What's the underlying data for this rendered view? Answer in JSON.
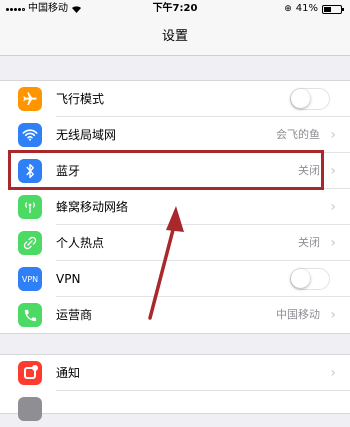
{
  "status_bar": {
    "carrier": "中国移动",
    "time": "下午7:20",
    "battery_percent": "41%",
    "battery_level": 0.41
  },
  "nav": {
    "title": "设置"
  },
  "group1": {
    "airplane": {
      "label": "飞行模式",
      "on": false,
      "icon": "airplane-icon",
      "color": "#ff9500"
    },
    "wifi": {
      "label": "无线局域网",
      "value": "会飞的鱼",
      "icon": "wifi-icon",
      "color": "#2f7ff6"
    },
    "bluetooth": {
      "label": "蓝牙",
      "value": "关闭",
      "icon": "bluetooth-icon",
      "color": "#2f7ff6"
    },
    "cellular": {
      "label": "蜂窝移动网络",
      "icon": "antenna-icon",
      "color": "#4cd964"
    },
    "hotspot": {
      "label": "个人热点",
      "value": "关闭",
      "icon": "hotspot-icon",
      "color": "#4cd964"
    },
    "vpn": {
      "label": "VPN",
      "icon_text": "VPN",
      "on": false,
      "icon": "vpn-icon",
      "color": "#2f7ff6"
    },
    "carrier": {
      "label": "运营商",
      "value": "中国移动",
      "icon": "phone-icon",
      "color": "#4cd964"
    }
  },
  "group2": {
    "notifications": {
      "label": "通知",
      "icon": "notification-icon",
      "color": "#ff3b30"
    }
  },
  "annotation": {
    "color": "#a8282c"
  }
}
